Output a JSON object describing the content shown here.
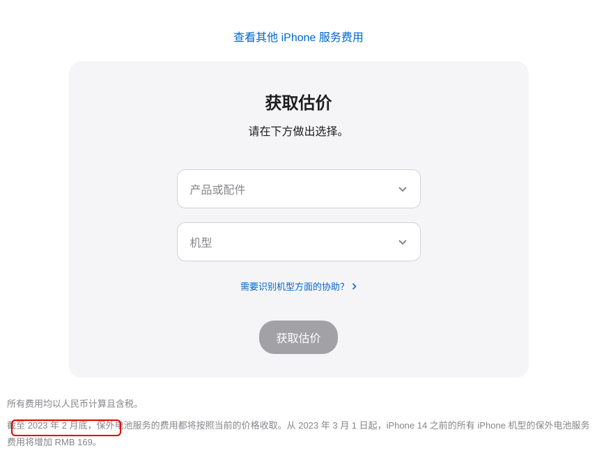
{
  "topLink": "查看其他 iPhone 服务费用",
  "card": {
    "title": "获取估价",
    "subtitle": "请在下方做出选择。",
    "select1": {
      "placeholder": "产品或配件"
    },
    "select2": {
      "placeholder": "机型"
    },
    "helpLink": "需要识别机型方面的协助？",
    "submit": "获取估价"
  },
  "footnotes": {
    "line1": "所有费用均以人民币计算且含税。",
    "line2": "截至 2023 年 2 月底，保外电池服务的费用都将按照当前的价格收取。从 2023 年 3 月 1 日起，iPhone 14 之前的所有 iPhone 机型的保外电池服务费用将增加 RMB 169。"
  }
}
